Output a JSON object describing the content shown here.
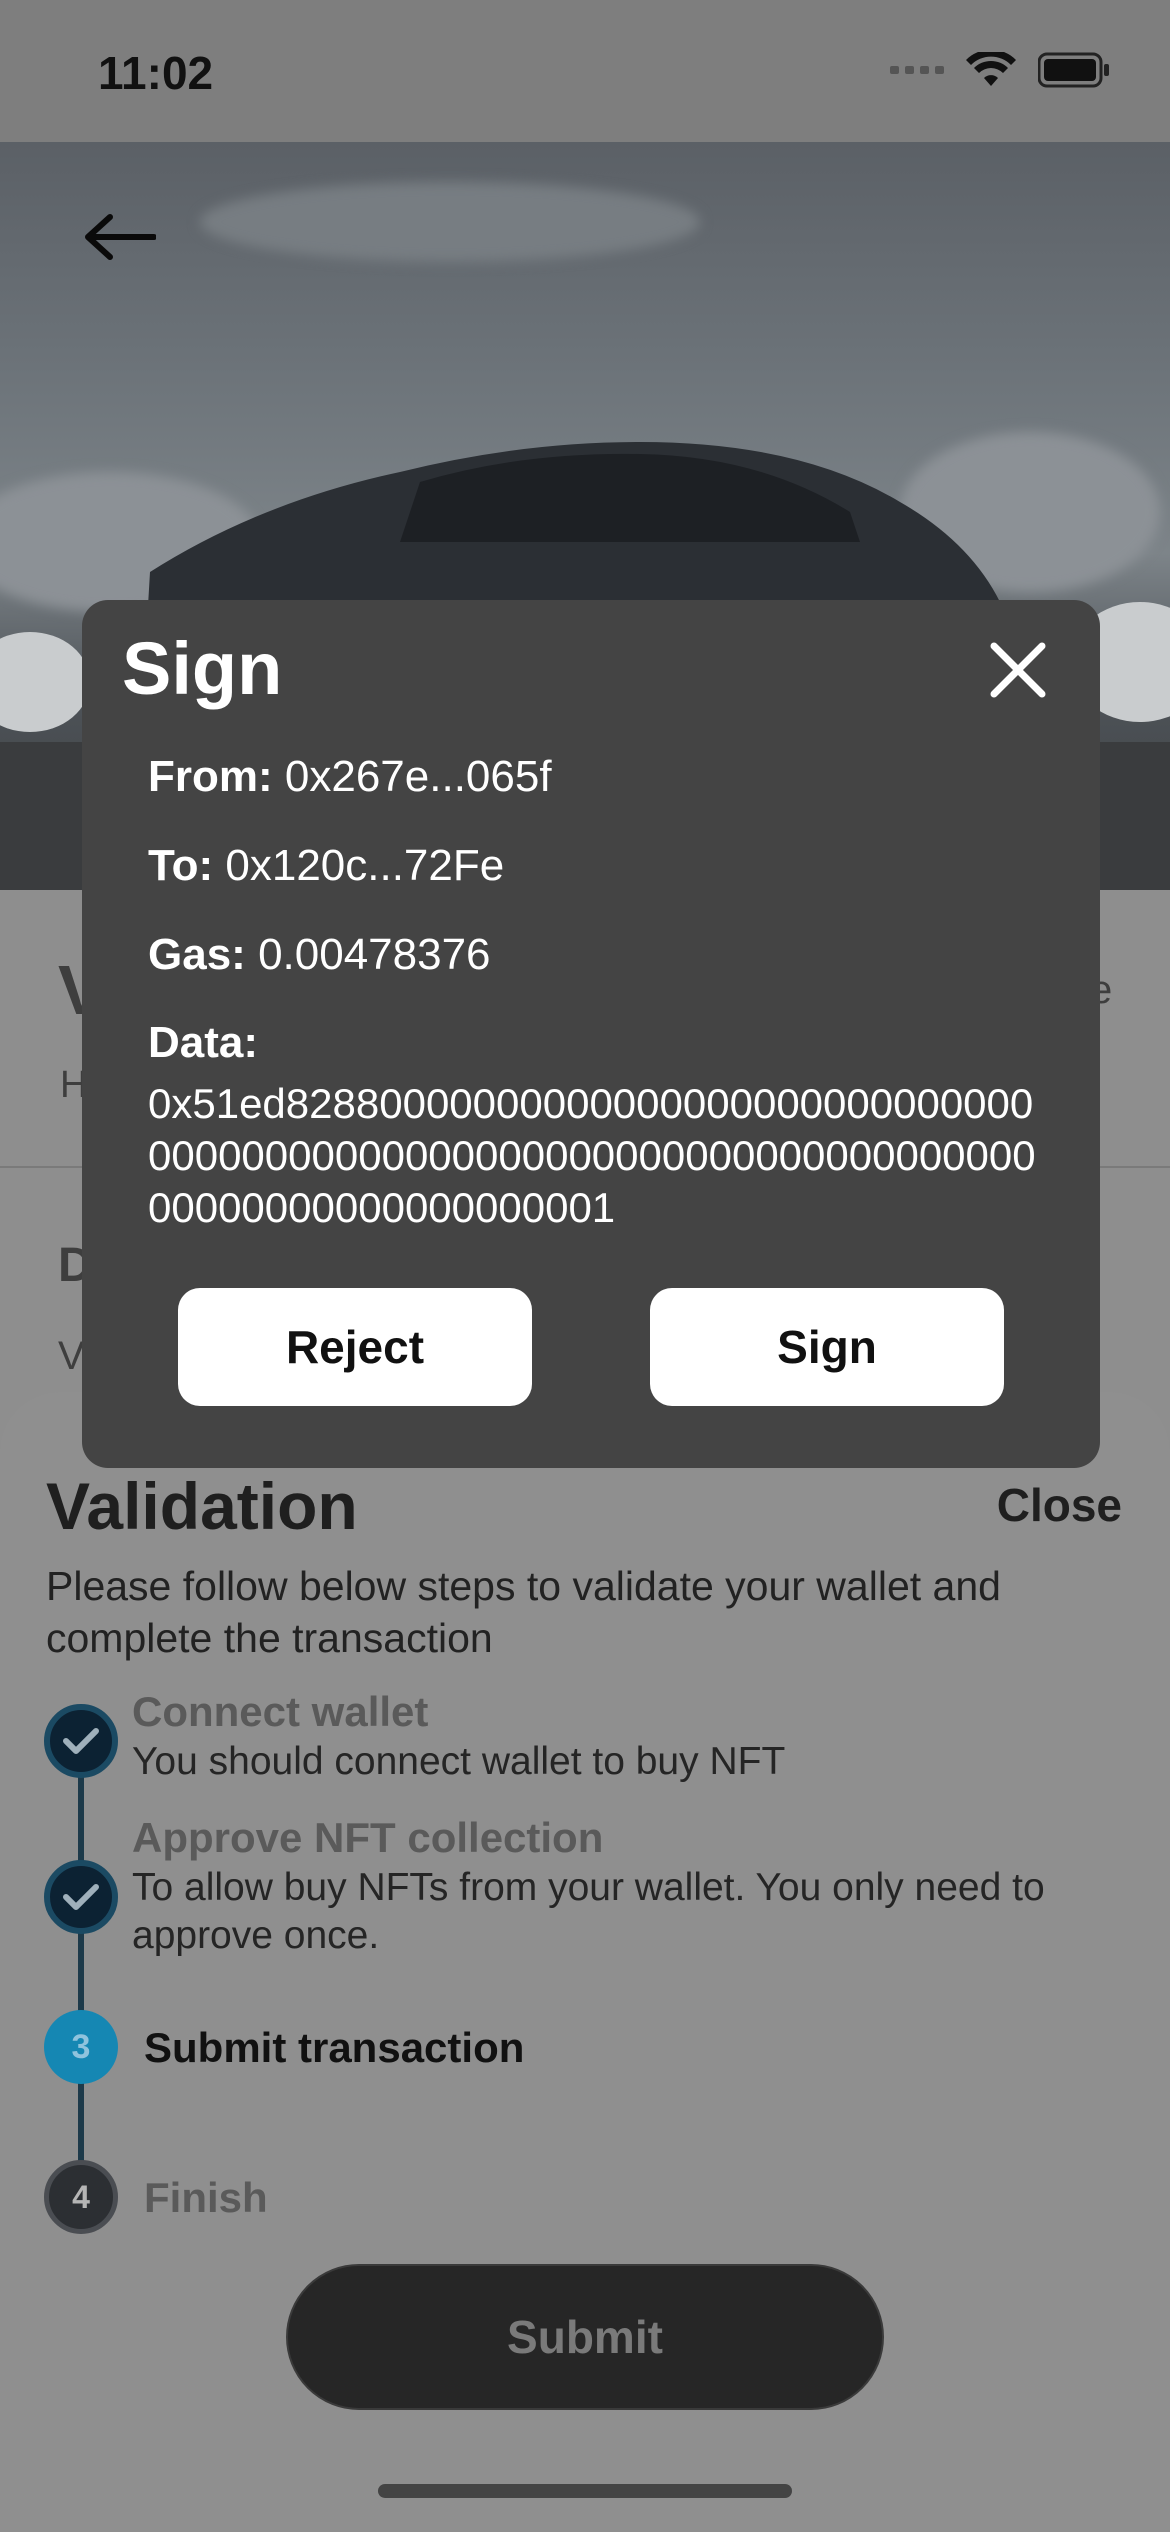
{
  "status_bar": {
    "time": "11:02"
  },
  "background_page": {
    "title_fragment": "V",
    "subtitle_fragment": "H",
    "right_fragment": "e",
    "section_fragment": "D",
    "line_fragment": "V"
  },
  "sign_modal": {
    "title": "Sign",
    "from_label": "From:",
    "from_value": "0x267e...065f",
    "to_label": "To:",
    "to_value": "0x120c...72Fe",
    "gas_label": "Gas:",
    "gas_value": "0.00478376",
    "data_label": "Data:",
    "data_value": "0x51ed828800000000000000000000000000000000000000000000000000000000000000000000000000000000000001",
    "reject_label": "Reject",
    "sign_label": "Sign"
  },
  "validation_sheet": {
    "title": "Validation",
    "close_label": "Close",
    "description": "Please follow below steps to validate your wallet and complete the transaction",
    "steps": [
      {
        "status": "done",
        "title": "Connect wallet",
        "subtitle": "You should connect wallet to buy NFT"
      },
      {
        "status": "done",
        "title": "Approve NFT collection",
        "subtitle": "To allow buy NFTs from your wallet. You only need to approve once."
      },
      {
        "status": "active",
        "number": "3",
        "title": "Submit transaction"
      },
      {
        "status": "pending",
        "number": "4",
        "title": "Finish"
      }
    ],
    "submit_label": "Submit"
  }
}
